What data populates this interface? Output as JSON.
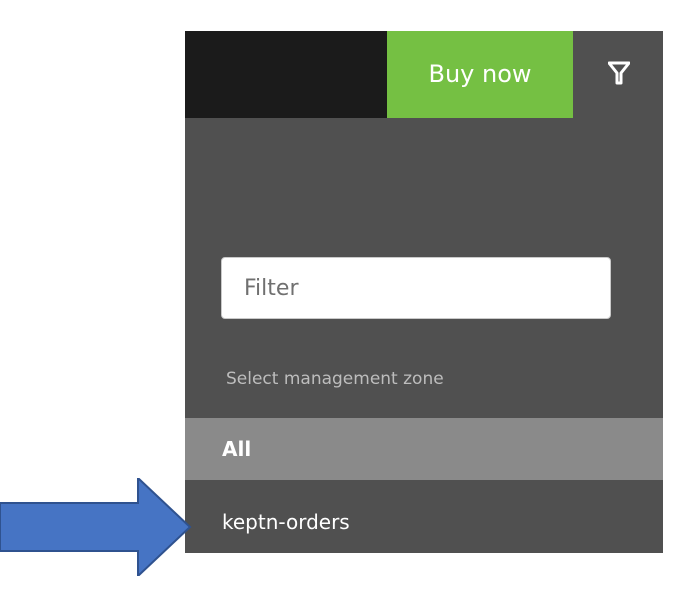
{
  "header": {
    "buy_button_label": "Buy now",
    "filter_icon": "filter-icon"
  },
  "filter": {
    "placeholder": "Filter",
    "value": ""
  },
  "management_zone": {
    "section_label": "Select management zone",
    "items": [
      {
        "label": "All",
        "selected": true
      },
      {
        "label": "keptn-orders",
        "selected": false
      }
    ]
  },
  "annotation": {
    "icon": "arrow-right-icon",
    "color": "#4674c4"
  },
  "colors": {
    "panel_bg": "#505050",
    "topbar_dark": "#1b1b1b",
    "accent_green": "#75c043",
    "selected_bg": "#8a8a8a"
  }
}
